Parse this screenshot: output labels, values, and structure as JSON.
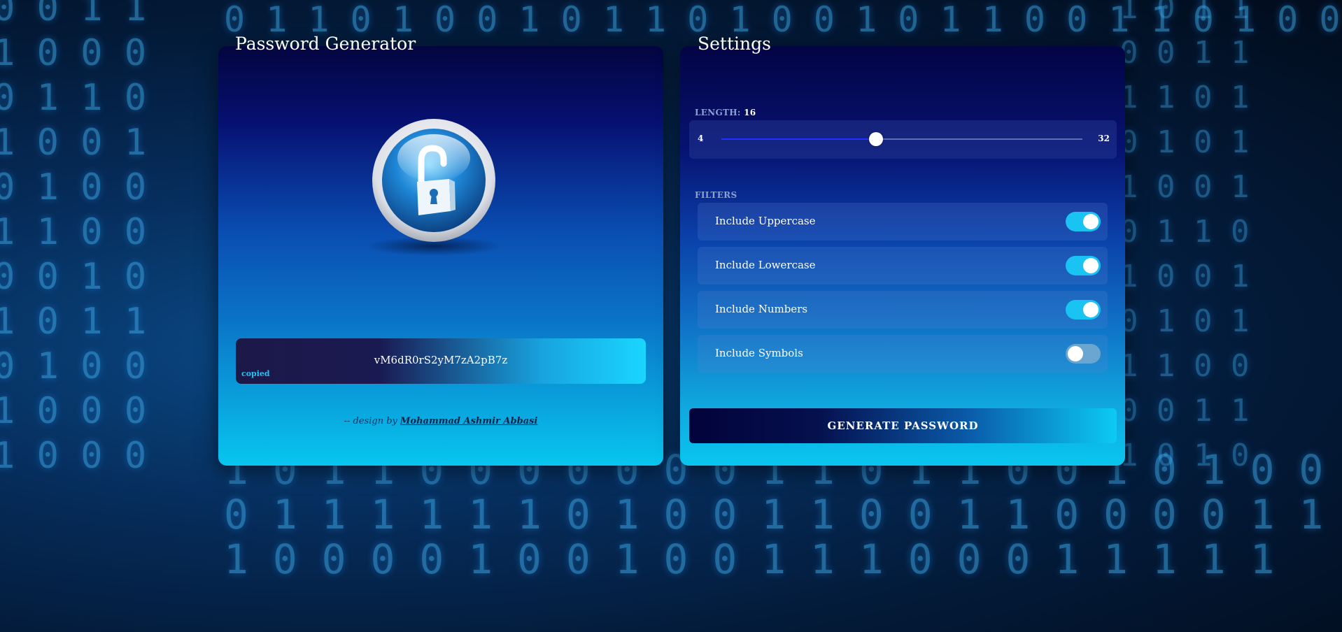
{
  "left_panel": {
    "title": "Password Generator",
    "password": "vM6dR0rS2yM7zA2pB7z",
    "copied_label": "copied",
    "credit_prefix": "-- design by ",
    "credit_author": "Mohammad Ashmir Abbasi",
    "lock_icon": "unlocked-padlock-icon"
  },
  "right_panel": {
    "title": "Settings",
    "length_label": "LENGTH:",
    "length_value": "16",
    "slider_min": "4",
    "slider_max": "32",
    "slider_fraction": 0.4286,
    "filters_label": "FILTERS",
    "filters": [
      {
        "label": "Include Uppercase",
        "checked": true
      },
      {
        "label": "Include Lowercase",
        "checked": true
      },
      {
        "label": "Include Numbers",
        "checked": true
      },
      {
        "label": "Include Symbols",
        "checked": false
      }
    ],
    "generate_label": "GENERATE PASSWORD"
  },
  "colors": {
    "toggle_on": "#19c3f2",
    "toggle_off": "#6aa6d0",
    "accent": "#1ad6ff"
  }
}
